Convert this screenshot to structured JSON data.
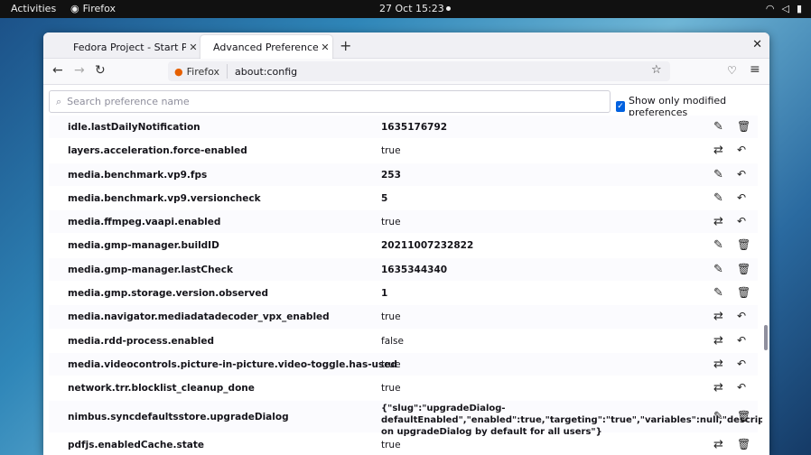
{
  "topbar": {
    "activities": "Activities",
    "app_name": "Firefox",
    "clock": "27 Oct  15:23"
  },
  "tabs": [
    {
      "label": "Fedora Project - Start Page",
      "active": false
    },
    {
      "label": "Advanced Preferences",
      "active": true
    }
  ],
  "urlbar": {
    "identity": "Firefox",
    "url": "about:config"
  },
  "search": {
    "placeholder": "Search preference name",
    "show_modified_label": "Show only modified preferences",
    "show_modified_checked": true
  },
  "prefs": [
    {
      "name": "idle.lastDailyNotification",
      "value": "1635176792",
      "bold_value": true,
      "actions": [
        "edit-icon",
        "trash-icon"
      ]
    },
    {
      "name": "layers.acceleration.force-enabled",
      "value": "true",
      "bold_value": false,
      "actions": [
        "toggle-icon",
        "reset-icon"
      ]
    },
    {
      "name": "media.benchmark.vp9.fps",
      "value": "253",
      "bold_value": true,
      "actions": [
        "edit-icon",
        "reset-icon"
      ]
    },
    {
      "name": "media.benchmark.vp9.versioncheck",
      "value": "5",
      "bold_value": true,
      "actions": [
        "edit-icon",
        "reset-icon"
      ]
    },
    {
      "name": "media.ffmpeg.vaapi.enabled",
      "value": "true",
      "bold_value": false,
      "actions": [
        "toggle-icon",
        "reset-icon"
      ]
    },
    {
      "name": "media.gmp-manager.buildID",
      "value": "20211007232822",
      "bold_value": true,
      "actions": [
        "edit-icon",
        "trash-icon"
      ]
    },
    {
      "name": "media.gmp-manager.lastCheck",
      "value": "1635344340",
      "bold_value": true,
      "actions": [
        "edit-icon",
        "trash-icon"
      ]
    },
    {
      "name": "media.gmp.storage.version.observed",
      "value": "1",
      "bold_value": true,
      "actions": [
        "edit-icon",
        "trash-icon"
      ]
    },
    {
      "name": "media.navigator.mediadatadecoder_vpx_enabled",
      "value": "true",
      "bold_value": false,
      "actions": [
        "toggle-icon",
        "reset-icon"
      ]
    },
    {
      "name": "media.rdd-process.enabled",
      "value": "false",
      "bold_value": false,
      "actions": [
        "toggle-icon",
        "reset-icon"
      ]
    },
    {
      "name": "media.videocontrols.picture-in-picture.video-toggle.has-used",
      "value": "true",
      "bold_value": false,
      "actions": [
        "toggle-icon",
        "reset-icon"
      ]
    },
    {
      "name": "network.trr.blocklist_cleanup_done",
      "value": "true",
      "bold_value": false,
      "actions": [
        "toggle-icon",
        "reset-icon"
      ]
    },
    {
      "name": "nimbus.syncdefaultsstore.upgradeDialog",
      "value": "{\"slug\":\"upgradeDialog-defaultEnabled\",\"enabled\":true,\"targeting\":\"true\",\"variables\":null,\"description\":\"Turn on upgradeDialog by default for all users\"}",
      "bold_value": true,
      "actions": [
        "edit-icon",
        "trash-icon"
      ]
    },
    {
      "name": "pdfjs.enabledCache.state",
      "value": "true",
      "bold_value": false,
      "actions": [
        "toggle-icon",
        "trash-icon"
      ]
    }
  ]
}
